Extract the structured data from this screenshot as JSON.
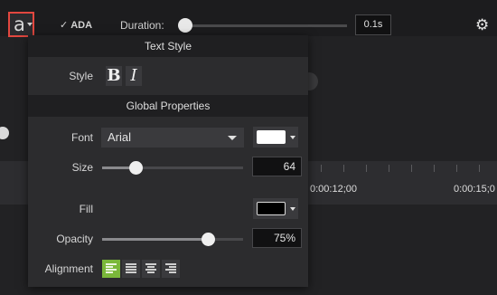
{
  "toolbar": {
    "font_button_glyph": "a",
    "ada_label": "ADA",
    "ada_check": "✓",
    "duration_label": "Duration:",
    "duration_value": "0.1s",
    "gear_glyph": "⚙"
  },
  "popup": {
    "text_style_header": "Text Style",
    "style_label": "Style",
    "bold_glyph": "B",
    "italic_glyph": "I",
    "global_header": "Global Properties",
    "font_label": "Font",
    "font_value": "Arial",
    "font_color": "#ffffff",
    "size_label": "Size",
    "size_value": "64",
    "size_level_fraction": 0.24,
    "fill_label": "Fill",
    "fill_color": "#000000",
    "opacity_label": "Opacity",
    "opacity_value": "75%",
    "opacity_fraction": 0.75,
    "alignment_label": "Alignment",
    "alignment_options": [
      "left",
      "justify",
      "center",
      "right"
    ],
    "alignment_selected": "left"
  },
  "timeline": {
    "labels": [
      "0:00:12;00",
      "0:00:15;0"
    ]
  },
  "colors": {
    "accent_green": "#7ab83a",
    "highlight_red": "#e2473f"
  }
}
